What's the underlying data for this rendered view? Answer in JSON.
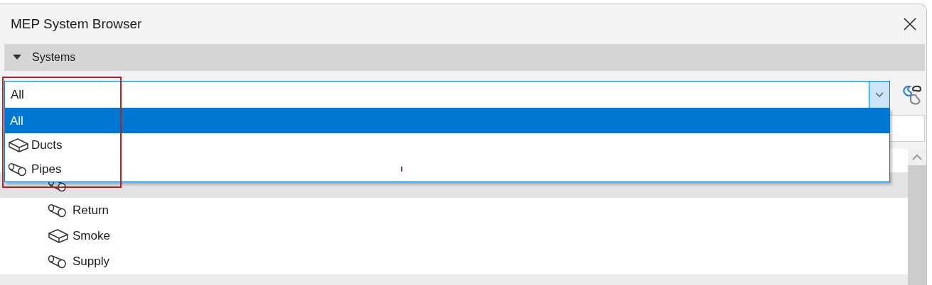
{
  "window": {
    "title": "MEP System Browser"
  },
  "section": {
    "label": "Systems",
    "expanded": true
  },
  "filter": {
    "value": "All"
  },
  "dropdown": {
    "options": [
      {
        "label": "All",
        "kind": "all",
        "selected": true
      },
      {
        "label": "Ducts",
        "kind": "duct",
        "selected": false
      },
      {
        "label": "Pipes",
        "kind": "pipe",
        "selected": false
      }
    ]
  },
  "tree": {
    "items": [
      {
        "kind": "pipe",
        "selected": true
      },
      {
        "label": "Return",
        "kind": "pipe",
        "selected": false
      },
      {
        "label": "Smoke",
        "kind": "duct",
        "selected": false
      },
      {
        "label": "Supply",
        "kind": "pipe",
        "selected": false
      }
    ]
  }
}
